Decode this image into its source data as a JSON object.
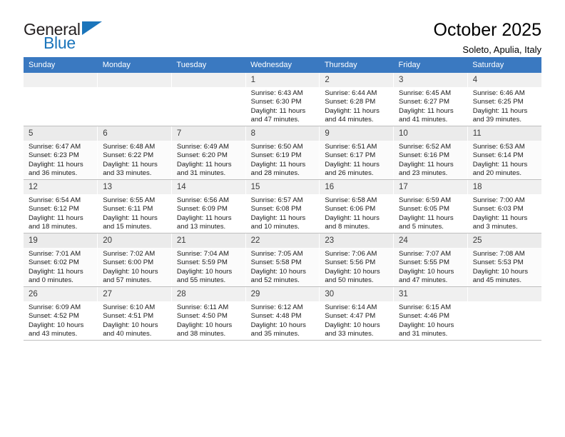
{
  "brand": {
    "name_part1": "General",
    "name_part2": "Blue",
    "triangle_color": "#1b75bb"
  },
  "header": {
    "title": "October 2025",
    "subtitle": "Soleto, Apulia, Italy",
    "header_bg": "#3a79c1"
  },
  "weekdays": [
    "Sunday",
    "Monday",
    "Tuesday",
    "Wednesday",
    "Thursday",
    "Friday",
    "Saturday"
  ],
  "labels": {
    "sunrise": "Sunrise:",
    "sunset": "Sunset:",
    "daylight": "Daylight:"
  },
  "weeks": [
    [
      {
        "day": ""
      },
      {
        "day": ""
      },
      {
        "day": ""
      },
      {
        "day": "1",
        "sunrise": "Sunrise: 6:43 AM",
        "sunset": "Sunset: 6:30 PM",
        "daylight": "Daylight: 11 hours and 47 minutes."
      },
      {
        "day": "2",
        "sunrise": "Sunrise: 6:44 AM",
        "sunset": "Sunset: 6:28 PM",
        "daylight": "Daylight: 11 hours and 44 minutes."
      },
      {
        "day": "3",
        "sunrise": "Sunrise: 6:45 AM",
        "sunset": "Sunset: 6:27 PM",
        "daylight": "Daylight: 11 hours and 41 minutes."
      },
      {
        "day": "4",
        "sunrise": "Sunrise: 6:46 AM",
        "sunset": "Sunset: 6:25 PM",
        "daylight": "Daylight: 11 hours and 39 minutes."
      }
    ],
    [
      {
        "day": "5",
        "sunrise": "Sunrise: 6:47 AM",
        "sunset": "Sunset: 6:23 PM",
        "daylight": "Daylight: 11 hours and 36 minutes."
      },
      {
        "day": "6",
        "sunrise": "Sunrise: 6:48 AM",
        "sunset": "Sunset: 6:22 PM",
        "daylight": "Daylight: 11 hours and 33 minutes."
      },
      {
        "day": "7",
        "sunrise": "Sunrise: 6:49 AM",
        "sunset": "Sunset: 6:20 PM",
        "daylight": "Daylight: 11 hours and 31 minutes."
      },
      {
        "day": "8",
        "sunrise": "Sunrise: 6:50 AM",
        "sunset": "Sunset: 6:19 PM",
        "daylight": "Daylight: 11 hours and 28 minutes."
      },
      {
        "day": "9",
        "sunrise": "Sunrise: 6:51 AM",
        "sunset": "Sunset: 6:17 PM",
        "daylight": "Daylight: 11 hours and 26 minutes."
      },
      {
        "day": "10",
        "sunrise": "Sunrise: 6:52 AM",
        "sunset": "Sunset: 6:16 PM",
        "daylight": "Daylight: 11 hours and 23 minutes."
      },
      {
        "day": "11",
        "sunrise": "Sunrise: 6:53 AM",
        "sunset": "Sunset: 6:14 PM",
        "daylight": "Daylight: 11 hours and 20 minutes."
      }
    ],
    [
      {
        "day": "12",
        "sunrise": "Sunrise: 6:54 AM",
        "sunset": "Sunset: 6:12 PM",
        "daylight": "Daylight: 11 hours and 18 minutes."
      },
      {
        "day": "13",
        "sunrise": "Sunrise: 6:55 AM",
        "sunset": "Sunset: 6:11 PM",
        "daylight": "Daylight: 11 hours and 15 minutes."
      },
      {
        "day": "14",
        "sunrise": "Sunrise: 6:56 AM",
        "sunset": "Sunset: 6:09 PM",
        "daylight": "Daylight: 11 hours and 13 minutes."
      },
      {
        "day": "15",
        "sunrise": "Sunrise: 6:57 AM",
        "sunset": "Sunset: 6:08 PM",
        "daylight": "Daylight: 11 hours and 10 minutes."
      },
      {
        "day": "16",
        "sunrise": "Sunrise: 6:58 AM",
        "sunset": "Sunset: 6:06 PM",
        "daylight": "Daylight: 11 hours and 8 minutes."
      },
      {
        "day": "17",
        "sunrise": "Sunrise: 6:59 AM",
        "sunset": "Sunset: 6:05 PM",
        "daylight": "Daylight: 11 hours and 5 minutes."
      },
      {
        "day": "18",
        "sunrise": "Sunrise: 7:00 AM",
        "sunset": "Sunset: 6:03 PM",
        "daylight": "Daylight: 11 hours and 3 minutes."
      }
    ],
    [
      {
        "day": "19",
        "sunrise": "Sunrise: 7:01 AM",
        "sunset": "Sunset: 6:02 PM",
        "daylight": "Daylight: 11 hours and 0 minutes."
      },
      {
        "day": "20",
        "sunrise": "Sunrise: 7:02 AM",
        "sunset": "Sunset: 6:00 PM",
        "daylight": "Daylight: 10 hours and 57 minutes."
      },
      {
        "day": "21",
        "sunrise": "Sunrise: 7:04 AM",
        "sunset": "Sunset: 5:59 PM",
        "daylight": "Daylight: 10 hours and 55 minutes."
      },
      {
        "day": "22",
        "sunrise": "Sunrise: 7:05 AM",
        "sunset": "Sunset: 5:58 PM",
        "daylight": "Daylight: 10 hours and 52 minutes."
      },
      {
        "day": "23",
        "sunrise": "Sunrise: 7:06 AM",
        "sunset": "Sunset: 5:56 PM",
        "daylight": "Daylight: 10 hours and 50 minutes."
      },
      {
        "day": "24",
        "sunrise": "Sunrise: 7:07 AM",
        "sunset": "Sunset: 5:55 PM",
        "daylight": "Daylight: 10 hours and 47 minutes."
      },
      {
        "day": "25",
        "sunrise": "Sunrise: 7:08 AM",
        "sunset": "Sunset: 5:53 PM",
        "daylight": "Daylight: 10 hours and 45 minutes."
      }
    ],
    [
      {
        "day": "26",
        "sunrise": "Sunrise: 6:09 AM",
        "sunset": "Sunset: 4:52 PM",
        "daylight": "Daylight: 10 hours and 43 minutes."
      },
      {
        "day": "27",
        "sunrise": "Sunrise: 6:10 AM",
        "sunset": "Sunset: 4:51 PM",
        "daylight": "Daylight: 10 hours and 40 minutes."
      },
      {
        "day": "28",
        "sunrise": "Sunrise: 6:11 AM",
        "sunset": "Sunset: 4:50 PM",
        "daylight": "Daylight: 10 hours and 38 minutes."
      },
      {
        "day": "29",
        "sunrise": "Sunrise: 6:12 AM",
        "sunset": "Sunset: 4:48 PM",
        "daylight": "Daylight: 10 hours and 35 minutes."
      },
      {
        "day": "30",
        "sunrise": "Sunrise: 6:14 AM",
        "sunset": "Sunset: 4:47 PM",
        "daylight": "Daylight: 10 hours and 33 minutes."
      },
      {
        "day": "31",
        "sunrise": "Sunrise: 6:15 AM",
        "sunset": "Sunset: 4:46 PM",
        "daylight": "Daylight: 10 hours and 31 minutes."
      },
      {
        "day": ""
      }
    ]
  ]
}
